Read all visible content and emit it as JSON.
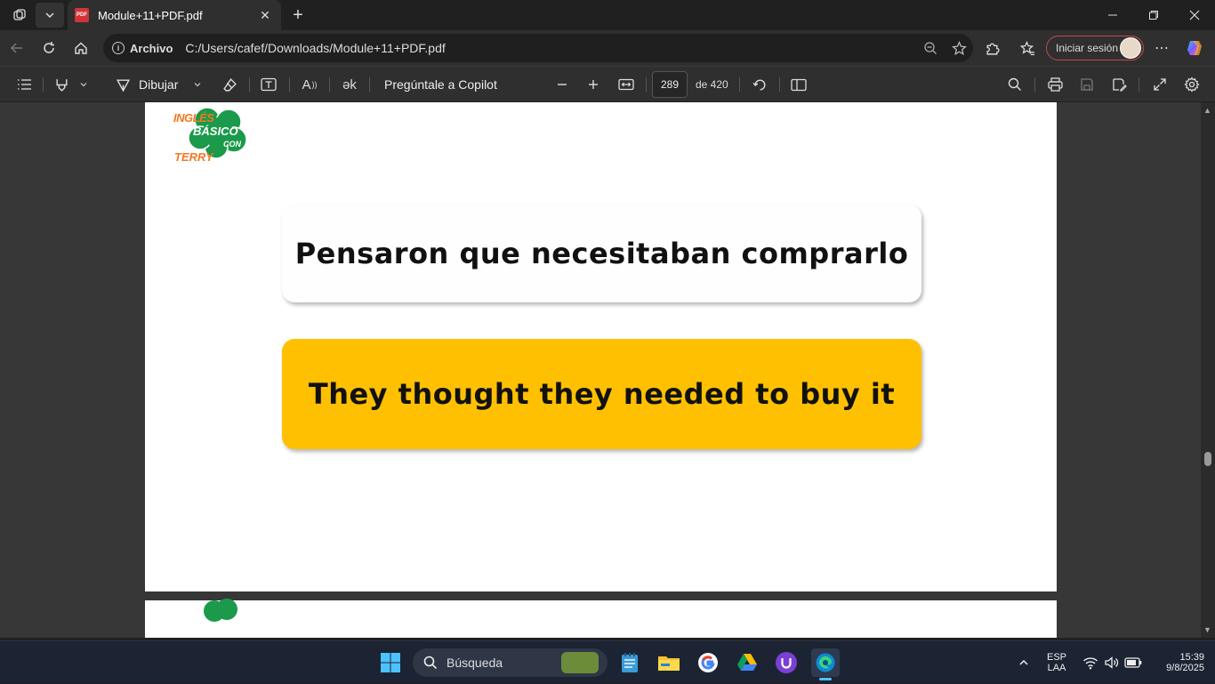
{
  "browser": {
    "tab_title": "Module+11+PDF.pdf",
    "tab_badge": "PDF",
    "url_label": "Archivo",
    "url": "C:/Users/cafef/Downloads/Module+11+PDF.pdf",
    "signin_label": "Iniciar sesión"
  },
  "pdf_toolbar": {
    "draw_label": "Dibujar",
    "copilot_label": "Pregúntale a Copilot",
    "read_aloud_glyph": "A",
    "translate_glyph": "ək",
    "page_number": "289",
    "page_total": "de 420"
  },
  "document": {
    "logo": {
      "line1": "INGLÉS",
      "line2": "BÁSICO",
      "line3": "CON",
      "line4": "TERRY"
    },
    "spanish_sentence": "Pensaron que necesitaban comprarlo",
    "english_sentence": "They thought they needed to buy it"
  },
  "taskbar": {
    "search_placeholder": "Búsqueda",
    "lang_top": "ESP",
    "lang_bottom": "LAA",
    "time": "15:39",
    "date": "9/8/2025"
  },
  "colors": {
    "highlight_card": "#fec000",
    "signin_border": "#c14a4a",
    "logo_green": "#1a9a4a",
    "logo_orange": "#f07a20"
  }
}
